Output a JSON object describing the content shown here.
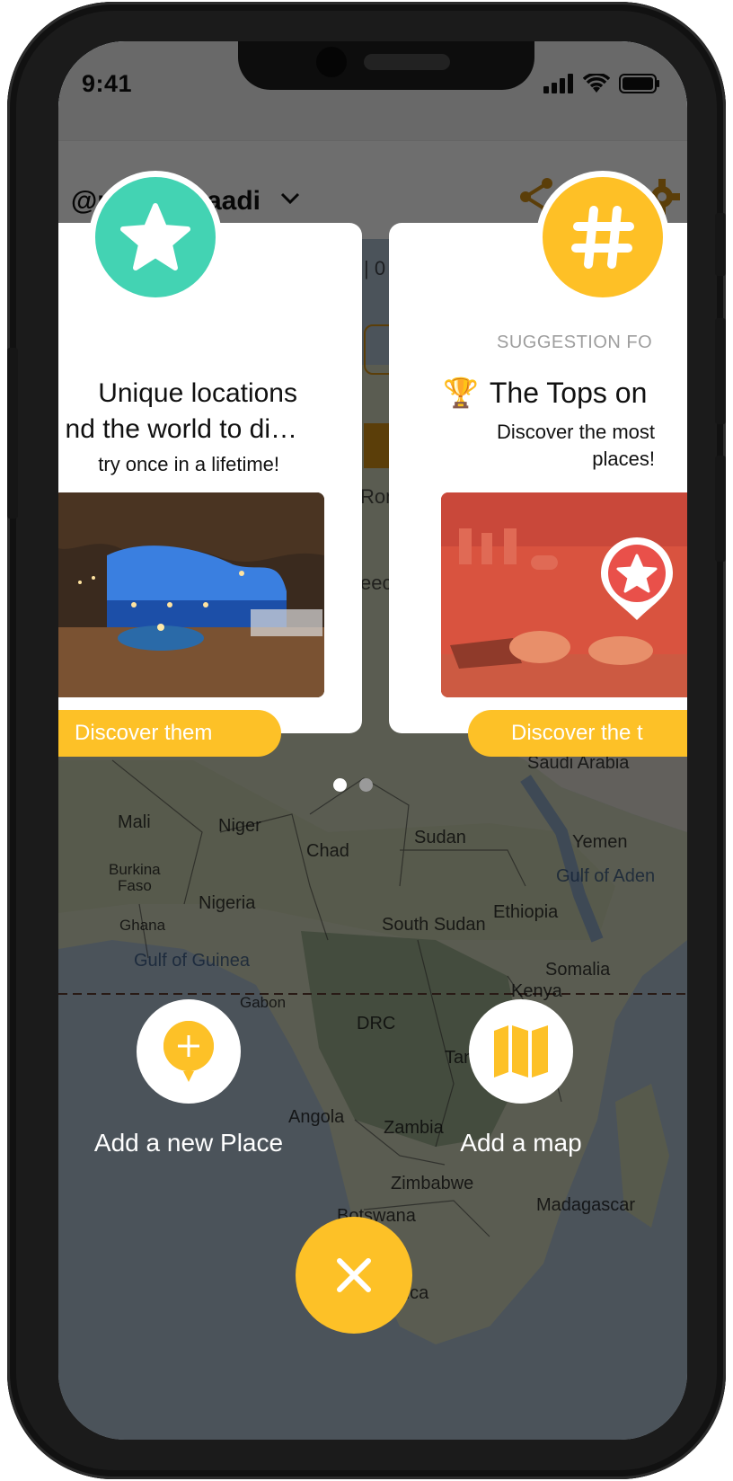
{
  "status_bar": {
    "time": "9:41"
  },
  "header": {
    "username": "@nayan.maadi"
  },
  "background_peek": {
    "counter_fragment": "| 0",
    "map_fragment_1": "Rom",
    "map_fragment_2": "eece"
  },
  "carousel": {
    "cards": [
      {
        "icon": "star-icon",
        "color": "#43d3b3",
        "title_line1": "Unique locations",
        "title_line2": "nd the world to di…",
        "subtitle": "try once in a lifetime!",
        "image": "cave-restaurant-photo",
        "button_label": "Discover them"
      },
      {
        "icon": "hashtag-icon",
        "color": "#fec026",
        "label": "SUGGESTION FO",
        "title_emoji": "🏆",
        "title": "The Tops on",
        "description_line1": "Discover the most",
        "description_line2": "places!",
        "image": "food-stall-photo",
        "button_label": "Discover the t"
      }
    ],
    "page_count": 2,
    "active_page": 1
  },
  "map_labels": [
    {
      "text": "Saudi Arabia",
      "water": false
    },
    {
      "text": "Mali",
      "water": false
    },
    {
      "text": "Niger",
      "water": false
    },
    {
      "text": "Chad",
      "water": false
    },
    {
      "text": "Sudan",
      "water": false
    },
    {
      "text": "Yemen",
      "water": false
    },
    {
      "text": "Gulf of Aden",
      "water": true
    },
    {
      "text": "Burkina",
      "water": false
    },
    {
      "text": "Faso",
      "water": false
    },
    {
      "text": "Nigeria",
      "water": false
    },
    {
      "text": "Ethiopia",
      "water": false
    },
    {
      "text": "Ghana",
      "water": false
    },
    {
      "text": "South Sudan",
      "water": false
    },
    {
      "text": "Gulf of Guinea",
      "water": true
    },
    {
      "text": "Somalia",
      "water": false
    },
    {
      "text": "Kenya",
      "water": false
    },
    {
      "text": "Gabon",
      "water": false
    },
    {
      "text": "DRC",
      "water": false
    },
    {
      "text": "Tan",
      "water": false
    },
    {
      "text": "Angola",
      "water": false
    },
    {
      "text": "Zambia",
      "water": false
    },
    {
      "text": "Zimbabwe",
      "water": false
    },
    {
      "text": "Madagascar",
      "water": false
    },
    {
      "text": "Botswana",
      "water": false
    },
    {
      "text": "rica",
      "water": false
    }
  ],
  "actions": {
    "add_place": "Add a new Place",
    "add_map": "Add a map"
  },
  "colors": {
    "accent_yellow": "#fdc127",
    "accent_teal": "#43d3b3",
    "pin_red": "#e9504a"
  }
}
